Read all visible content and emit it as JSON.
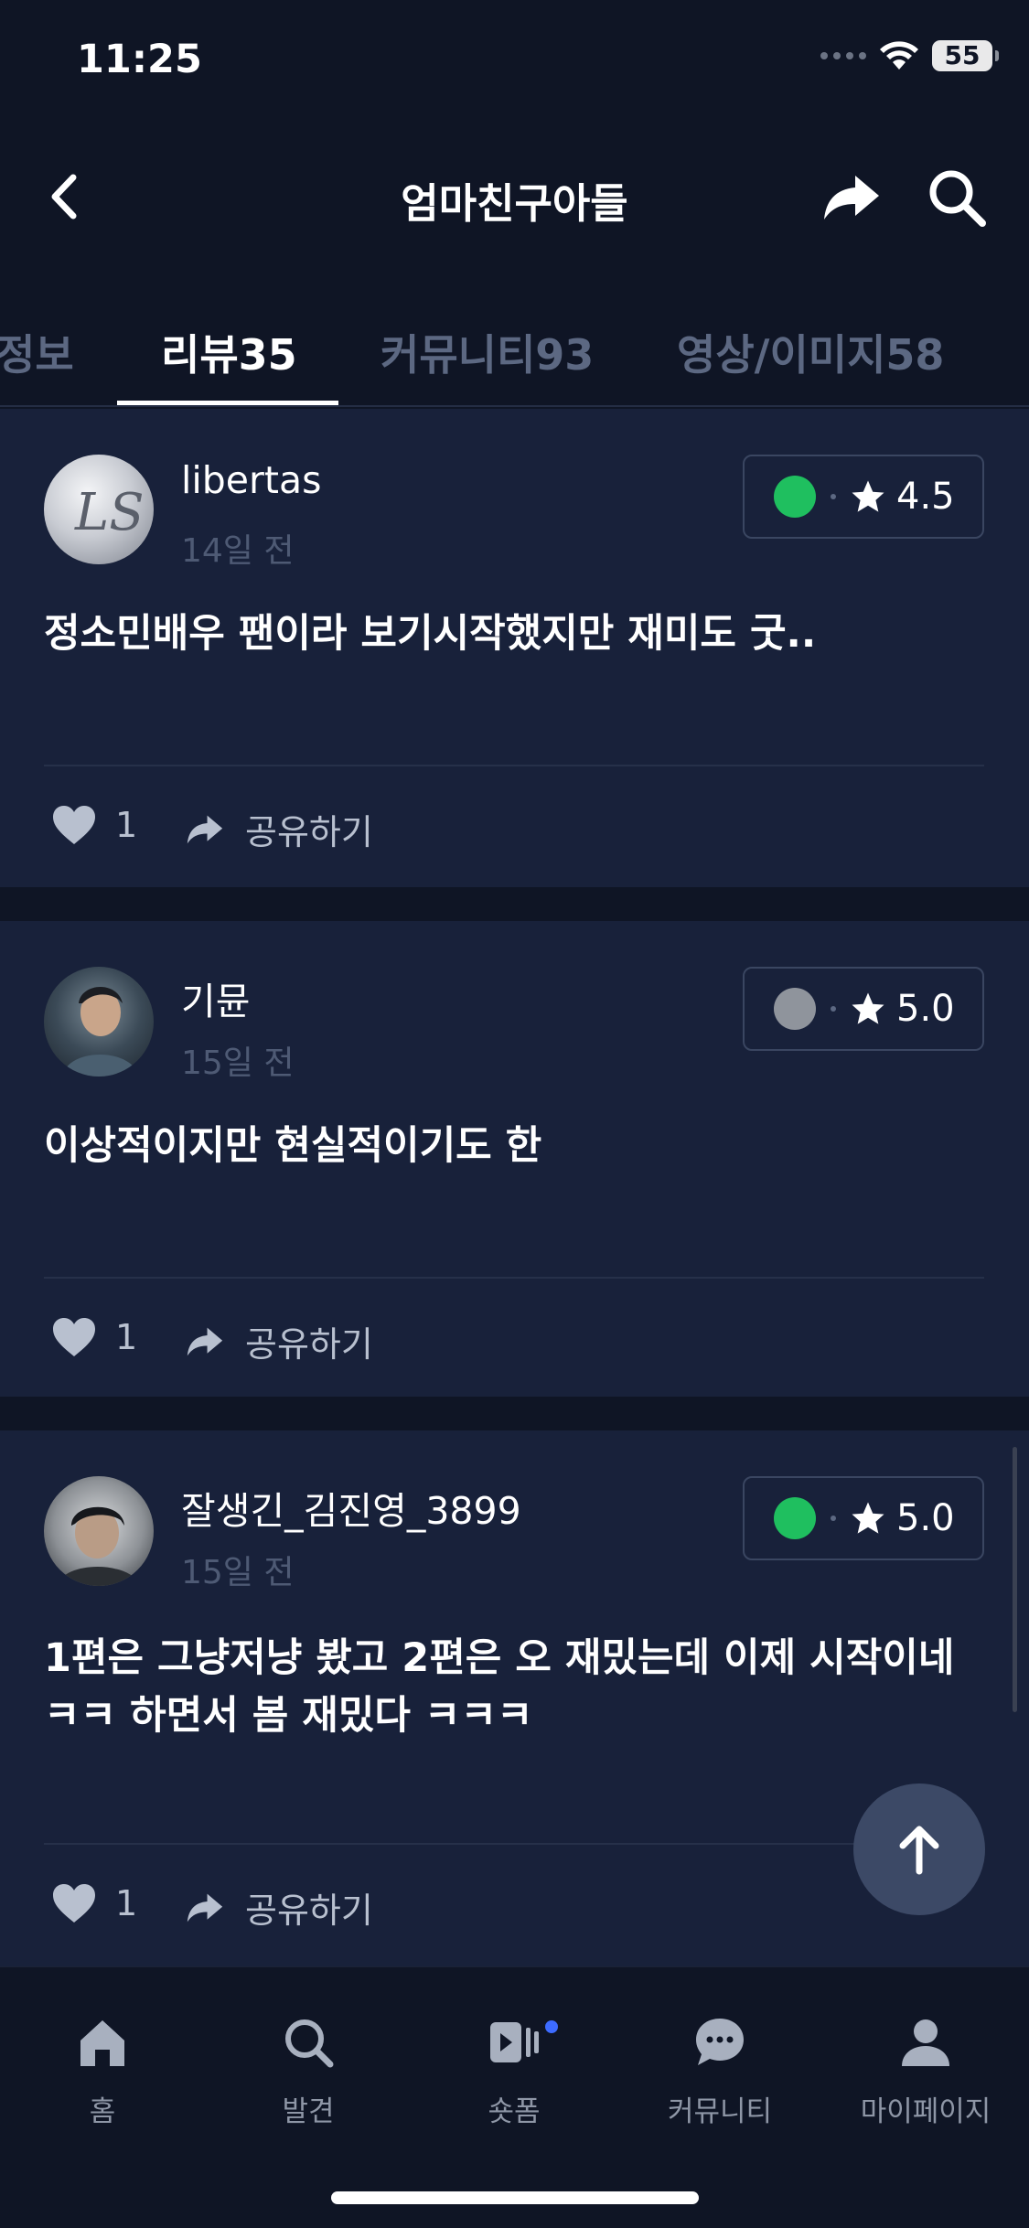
{
  "status_bar": {
    "time": "11:25",
    "battery": "55"
  },
  "header": {
    "title": "엄마친구아들"
  },
  "tabs": [
    {
      "label": "정보"
    },
    {
      "label": "리뷰35"
    },
    {
      "label": "커뮤니티93"
    },
    {
      "label": "영상/이미지58"
    }
  ],
  "reviews": [
    {
      "username": "libertas",
      "date": "14일 전",
      "status_color": "#1fbf5f",
      "rating": "4.5",
      "text": "정소민배우 팬이라 보기시작했지만 재미도 굿..",
      "likes": "1",
      "share_label": "공유하기"
    },
    {
      "username": "기뮨",
      "date": "15일 전",
      "status_color": "#8f949c",
      "rating": "5.0",
      "text": "이상적이지만 현실적이기도 한",
      "likes": "1",
      "share_label": "공유하기"
    },
    {
      "username": "잘생긴_김진영_3899",
      "date": "15일 전",
      "status_color": "#1fbf5f",
      "rating": "5.0",
      "text": "1편은 그냥저냥 봤고 2편은 오 재밌는데 이제 시작이네ㅋㅋ 하면서 봄 재밌다 ㅋㅋㅋ",
      "likes": "1",
      "share_label": "공유하기"
    }
  ],
  "bottom_nav": [
    {
      "label": "홈",
      "icon": "home-icon"
    },
    {
      "label": "발견",
      "icon": "search-icon"
    },
    {
      "label": "숏폼",
      "icon": "shortform-icon"
    },
    {
      "label": "커뮤니티",
      "icon": "chat-icon"
    },
    {
      "label": "마이페이지",
      "icon": "profile-icon"
    }
  ],
  "colors": {
    "background": "#0f1525",
    "card": "#18213a",
    "accent_green": "#1fbf5f",
    "badge_blue": "#3d6bff"
  }
}
